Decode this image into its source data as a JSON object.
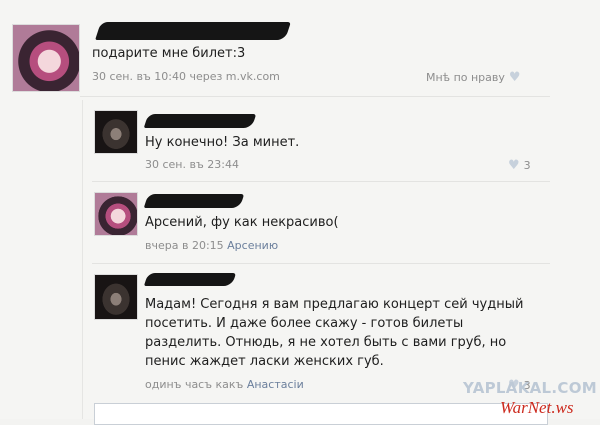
{
  "post": {
    "text": "подарите мне билет:3",
    "meta": "30 сен. въ 10:40 через m.vk.com",
    "like_label": "Мнѣ по нраву"
  },
  "comments": [
    {
      "text": "Ну конечно! За минет.",
      "meta": "30 сен. въ 23:44",
      "likes": "3"
    },
    {
      "text": "Арсений, фу как некрасиво(",
      "meta_time": "вчера в 20:15",
      "meta_reply": "Арсению"
    },
    {
      "lines": [
        "Мадам! Сегодня я вам предлагаю концерт сей чудный",
        "посетить. И даже более скажу - готов билеты",
        "разделить. Отнюдь, я не хотел быть с вами груб, но",
        "пенис жаждет ласки женских губ."
      ],
      "meta_time": "одинъ часъ какъ",
      "meta_reply": "Анастасiи",
      "likes": "3"
    }
  ],
  "watermarks": {
    "yaplakal": "YAPLAKAL.COM",
    "warnet": "WarNet.ws"
  },
  "icons": {
    "like": "heart-icon"
  },
  "colors": {
    "link": "#6b7f9c",
    "watermark_red": "#cc2a1e"
  }
}
